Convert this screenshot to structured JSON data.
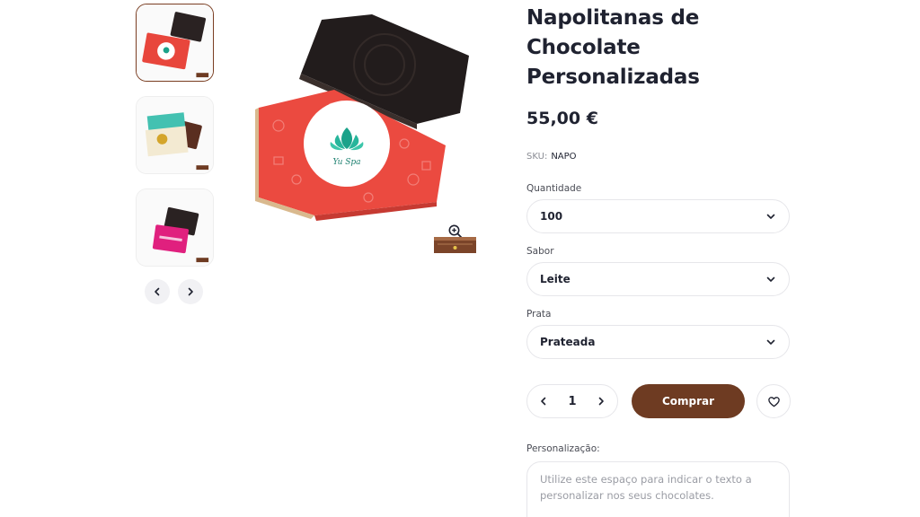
{
  "product": {
    "title": "Napolitanas de Chocolate Personalizadas",
    "price": "55,00 €",
    "sku_label": "SKU:",
    "sku_value": "NAPO"
  },
  "gallery": {
    "thumbnails": [
      {
        "label": "Napolitana Yu Spa",
        "active": true
      },
      {
        "label": "Napolitana ouro",
        "active": false
      },
      {
        "label": "Napolitana rosa",
        "active": false
      }
    ],
    "main_image_logo_text": "Yu Spa",
    "icons": {
      "prev": "chevron-left-icon",
      "next": "chevron-right-icon",
      "zoom": "zoom-in-icon"
    }
  },
  "options": {
    "quantidade": {
      "label": "Quantidade",
      "value": "100"
    },
    "sabor": {
      "label": "Sabor",
      "value": "Leite"
    },
    "prata": {
      "label": "Prata",
      "value": "Prateada"
    }
  },
  "cart": {
    "quantity": "1",
    "buy_label": "Comprar",
    "wishlist_icon": "heart-icon"
  },
  "personalization": {
    "label": "Personalização:",
    "placeholder": "Utilize este espaço para indicar o texto a personalizar nos seus chocolates."
  },
  "colors": {
    "brand": "#6e3b22",
    "wrapper": "#e8463c",
    "text": "#1f2230"
  }
}
